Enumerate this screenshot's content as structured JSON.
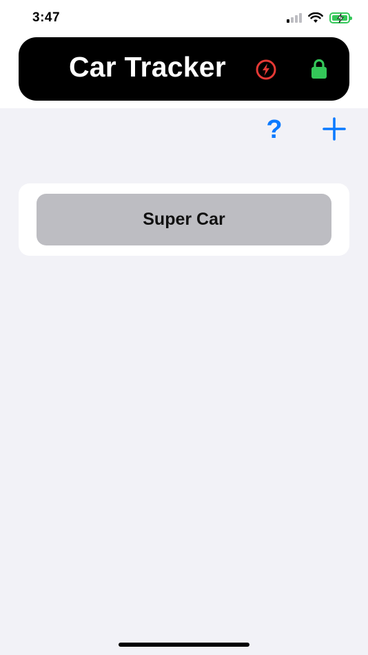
{
  "status_bar": {
    "time": "3:47",
    "icons": [
      "cellular-signal-icon",
      "wifi-icon",
      "battery-charging-icon"
    ]
  },
  "header": {
    "title": "Car Tracker",
    "bolt_icon": "bolt-circle-icon",
    "lock_icon": "lock-icon",
    "colors": {
      "bar": "#000000",
      "bolt": "#E53935",
      "lock": "#34C759"
    }
  },
  "toolbar": {
    "help_label": "?",
    "add_icon": "plus-icon",
    "accent": "#0A7AFF"
  },
  "cars": [
    {
      "name": "Super Car"
    }
  ]
}
